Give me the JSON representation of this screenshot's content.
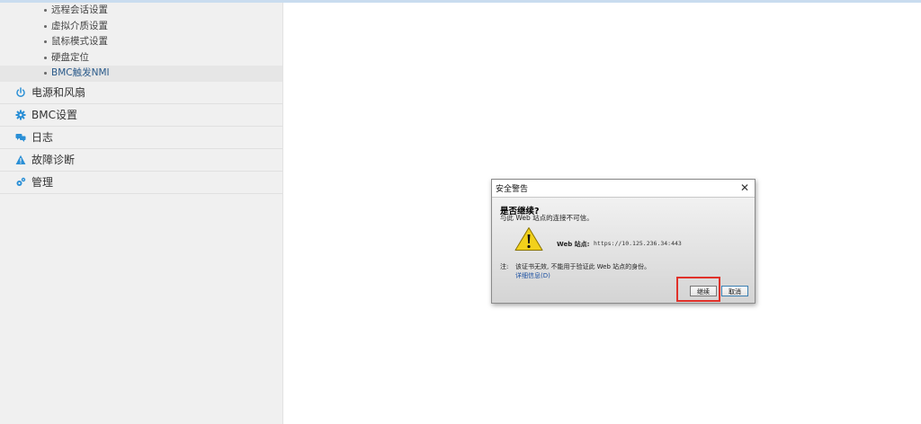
{
  "sidebar": {
    "sub_items": [
      {
        "label": "远程会话设置"
      },
      {
        "label": "虚拟介质设置"
      },
      {
        "label": "鼠标模式设置"
      },
      {
        "label": "硬盘定位"
      },
      {
        "label": "BMC触发NMI"
      }
    ],
    "active_sub_item": "BMC触发NMI",
    "items": [
      {
        "label": "电源和风扇",
        "icon": "power-icon"
      },
      {
        "label": "BMC设置",
        "icon": "gear-icon"
      },
      {
        "label": "日志",
        "icon": "chat-icon"
      },
      {
        "label": "故障诊断",
        "icon": "warning-icon"
      },
      {
        "label": "管理",
        "icon": "gears-icon"
      }
    ]
  },
  "dialog": {
    "title": "安全警告",
    "close": "✕",
    "heading": "是否继续?",
    "subtitle": "与此 Web 站点的连接不可信。",
    "site_label": "Web 站点:",
    "site_url": "https://10.125.236.34:443",
    "note_label": "注:",
    "note_text": "该证书无效, 不能用于验证此 Web 站点的身份。",
    "details_link": "详细信息(D)",
    "continue_button": "继续",
    "cancel_button": "取消"
  },
  "colors": {
    "icon_accent": "#2a8fd6",
    "highlight": "#e0312a",
    "warning": "#f2d11b"
  }
}
